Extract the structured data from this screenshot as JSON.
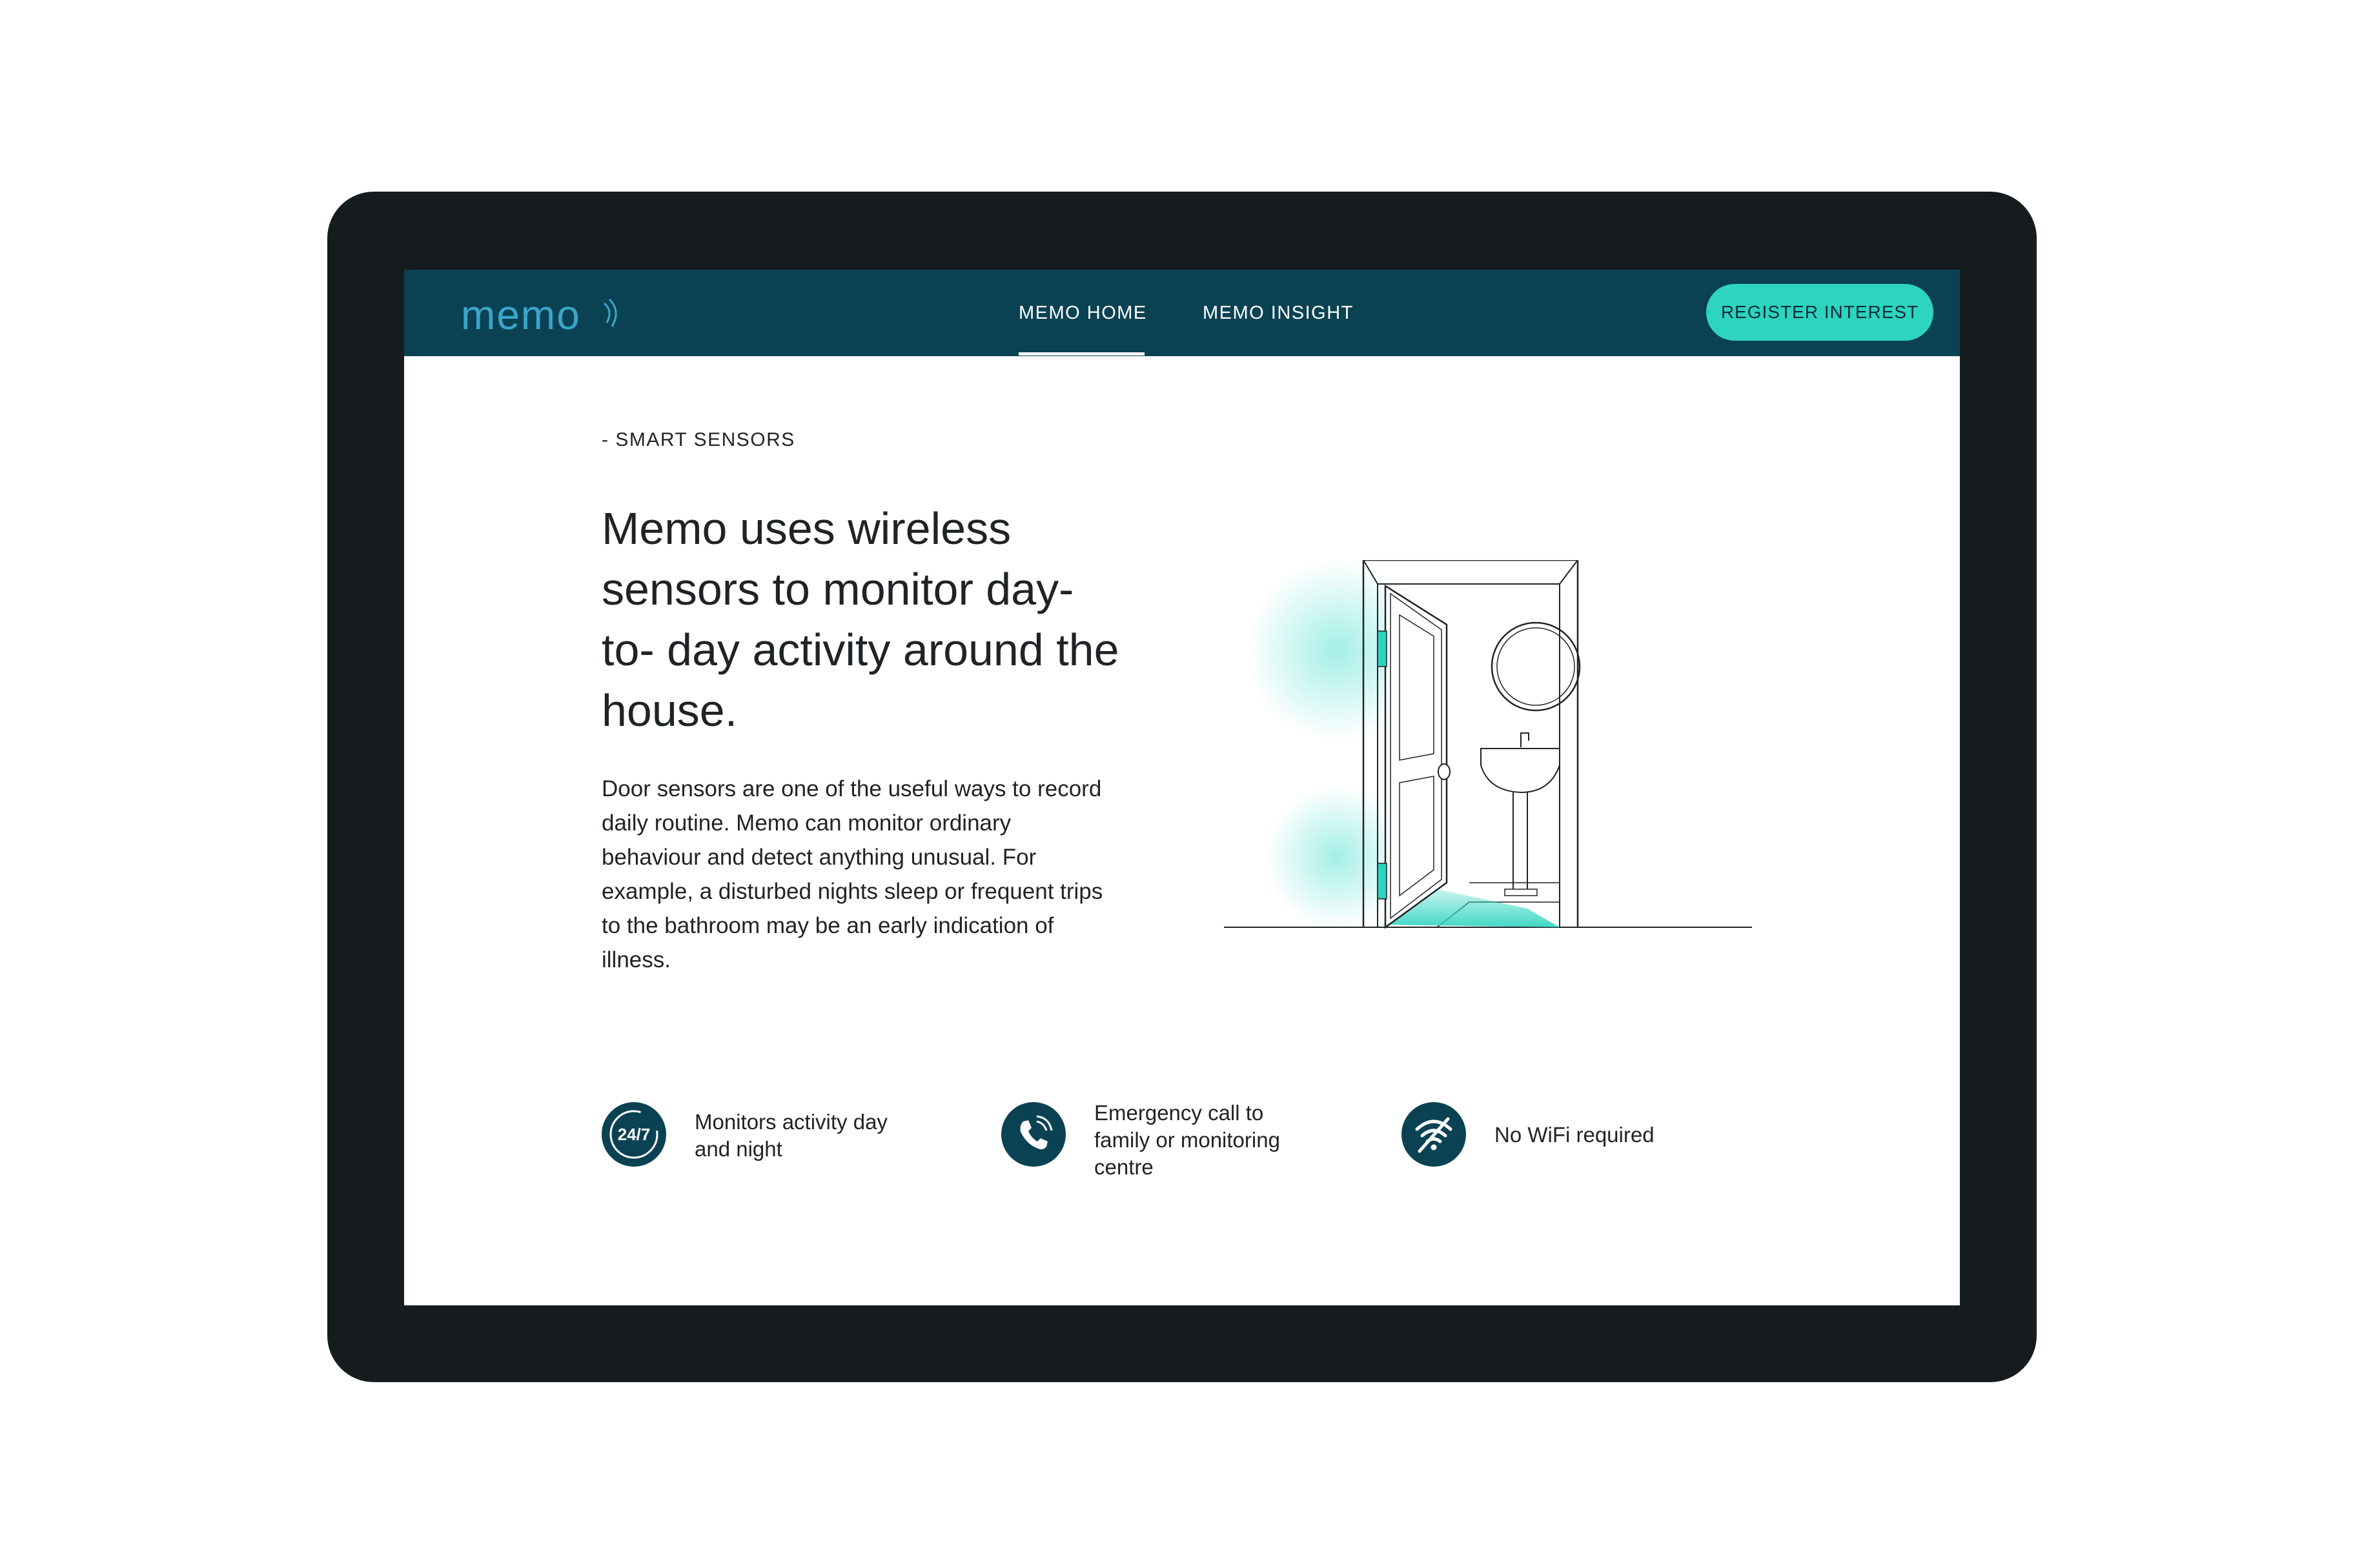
{
  "nav": {
    "logo_text": "memo",
    "items": [
      {
        "label": "MEMO HOME",
        "active": true
      },
      {
        "label": "MEMO INSIGHT",
        "active": false
      }
    ],
    "cta_label": "REGISTER INTEREST"
  },
  "hero": {
    "eyebrow": "- SMART SENSORS",
    "headline_lines": [
      "Memo uses wireless",
      "sensors to monitor day-",
      "to- day activity around the",
      "house."
    ],
    "body_lines": [
      "Door sensors are one of the useful ways to record",
      "daily routine. Memo can monitor ordinary",
      "behaviour and detect anything unusual. For",
      "example, a disturbed nights sleep or frequent trips",
      "to the bathroom may be an early indication of",
      "illness."
    ]
  },
  "features": [
    {
      "icon": "clock-24-7-icon",
      "icon_text": "24/7",
      "lines": [
        "Monitors activity day",
        "and night"
      ]
    },
    {
      "icon": "phone-call-icon",
      "lines": [
        "Emergency call to",
        "family or monitoring",
        "centre"
      ]
    },
    {
      "icon": "no-wifi-icon",
      "lines": [
        "No WiFi required"
      ]
    }
  ],
  "colors": {
    "navbar": "#0b4253",
    "accent": "#2dd4bf",
    "bezel": "#161b1e",
    "text": "#1f2326"
  }
}
